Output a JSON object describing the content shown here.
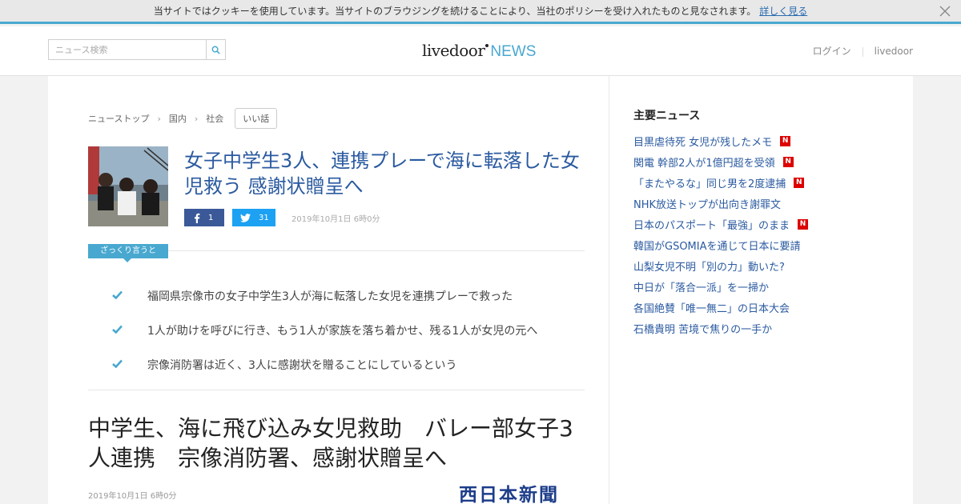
{
  "cookie": {
    "message": "当サイトではクッキーを使用しています。当サイトのブラウジングを続けることにより、当社のポリシーを受け入れたものと見なされます。",
    "link": "詳しく見る"
  },
  "header": {
    "search_placeholder": "ニュース検索",
    "logo_main": "livedoor",
    "logo_news": "NEWS",
    "login": "ログイン",
    "livedoor": "livedoor"
  },
  "breadcrumb": [
    "ニューストップ",
    "国内",
    "社会"
  ],
  "tag": "いい話",
  "article": {
    "title": "女子中学生3人、連携プレーで海に転落した女児救う 感謝状贈呈へ",
    "fb_count": "1",
    "tw_count": "31",
    "date": "2019年10月1日 6時0分",
    "summary_label": "ざっくり言うと",
    "summary": [
      "福岡県宗像市の女子中学生3人が海に転落した女児を連携プレーで救った",
      "1人が助けを呼びに行き、もう1人が家族を落ち着かせ、残る1人が女児の元へ",
      "宗像消防署は近く、3人に感謝状を贈ることにしているという"
    ],
    "body_title": "中学生、海に飛び込み女児救助　バレー部女子3人連携　宗像消防署、感謝状贈呈へ",
    "body_date": "2019年10月1日 6時0分",
    "source": "西日本新聞"
  },
  "sidebar": {
    "title": "主要ニュース",
    "items": [
      {
        "label": "目黒虐待死 女児が残したメモ",
        "badge": "N"
      },
      {
        "label": "関電 幹部2人が1億円超を受領",
        "badge": "N"
      },
      {
        "label": "「またやるな」同じ男を2度逮捕",
        "badge": "N"
      },
      {
        "label": "NHK放送トップが出向き謝罪文",
        "badge": ""
      },
      {
        "label": "日本のパスポート「最強」のまま",
        "badge": "N"
      },
      {
        "label": "韓国がGSOMIAを通じて日本に要請",
        "badge": ""
      },
      {
        "label": "山梨女児不明「別の力」動いた?",
        "badge": ""
      },
      {
        "label": "中日が「落合一派」を一掃か",
        "badge": ""
      },
      {
        "label": "各国絶賛「唯一無二」の日本大会",
        "badge": ""
      },
      {
        "label": "石橋貴明 苦境で焦りの一手か",
        "badge": ""
      }
    ]
  },
  "colors": {
    "accent": "#49a8d0",
    "link": "#2a5aa0",
    "facebook": "#3b5998",
    "twitter": "#1da1f2",
    "badge": "#dd0000"
  },
  "icons": [
    "close-icon",
    "search-icon",
    "facebook-icon",
    "twitter-icon",
    "check-icon",
    "chevron-right-icon"
  ]
}
